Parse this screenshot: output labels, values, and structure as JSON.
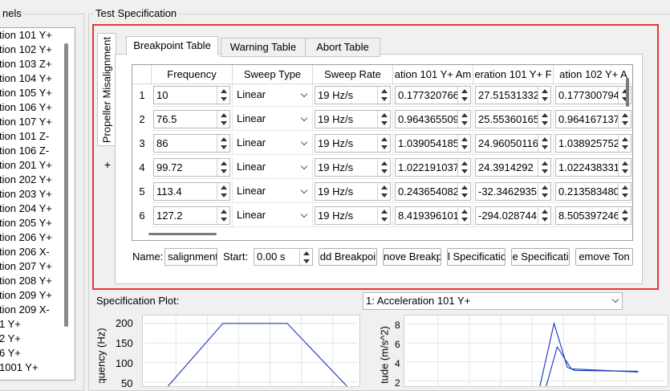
{
  "channels_panel": {
    "title": "nels",
    "items": [
      "tion 101 Y+",
      "tion 102 Y+",
      "tion 103 Z+",
      "tion 104 Y+",
      "tion 105 Y+",
      "tion 106 Y+",
      "tion 107 Y+",
      "tion 101 Z-",
      "tion 106 Z-",
      "tion 201 Y+",
      "tion 202 Y+",
      "tion 203 Y+",
      "tion 204 Y+",
      "tion 205 Y+",
      "tion 206 Y+",
      "tion 206 X-",
      "tion 207 Y+",
      "tion 208 Y+",
      "tion 209 Y+",
      "tion 209 X-",
      "1 Y+",
      "2 Y+",
      "6 Y+",
      "1001 Y+"
    ]
  },
  "spec": {
    "title": "Test Specification",
    "profile_tab": "Propeller Misalignment",
    "add_tab": "+",
    "tabs": [
      "Breakpoint Table",
      "Warning Table",
      "Abort Table"
    ],
    "table": {
      "columns": [
        "Frequency",
        "Sweep Type",
        "Sweep Rate",
        "ation 101 Y+ Am",
        "eration 101 Y+ F",
        "ation 102 Y+ A"
      ],
      "rows": [
        {
          "n": "1",
          "freq": "10",
          "type": "Linear",
          "rate": "19 Hz/s",
          "c1": "0.177320766",
          "c2": "27.51531332",
          "c3": "0.177300794"
        },
        {
          "n": "2",
          "freq": "76.5",
          "type": "Linear",
          "rate": "19 Hz/s",
          "c1": "0.964365509",
          "c2": "25.55360165",
          "c3": "0.964167137"
        },
        {
          "n": "3",
          "freq": "86",
          "type": "Linear",
          "rate": "19 Hz/s",
          "c1": "1.039054185",
          "c2": "24.96050116",
          "c3": "1.038925752"
        },
        {
          "n": "4",
          "freq": "99.72",
          "type": "Linear",
          "rate": "19 Hz/s",
          "c1": "1.022191037",
          "c2": "24.3914292",
          "c3": "1.022438331"
        },
        {
          "n": "5",
          "freq": "113.4",
          "type": "Linear",
          "rate": "19 Hz/s",
          "c1": "0.243654082",
          "c2": "-32.3462935",
          "c3": "0.213583480"
        },
        {
          "n": "6",
          "freq": "127.2",
          "type": "Linear",
          "rate": "19 Hz/s",
          "c1": "8.419396101",
          "c2": "-294.028744",
          "c3": "8.505397246"
        }
      ]
    },
    "name_label": "Name:",
    "name_value": "salignment",
    "start_label": "Start:",
    "start_value": "0.00 s",
    "buttons": [
      "dd Breakpoi",
      "nove Breakp",
      "l Specificatio",
      "e Specificati",
      "emove Ton"
    ]
  },
  "plot": {
    "title": "Specification Plot:",
    "selected": "1: Acceleration 101 Y+",
    "left_ylabel": "quency (Hz)",
    "left_ticks": [
      "200",
      "150",
      "100",
      "50"
    ],
    "right_ylabel": "itude (m/s^2)",
    "right_ticks": [
      "8",
      "6",
      "4",
      "2"
    ]
  },
  "colors": {
    "accent_red": "#e53935",
    "plot_line": "#1f3fbf"
  }
}
